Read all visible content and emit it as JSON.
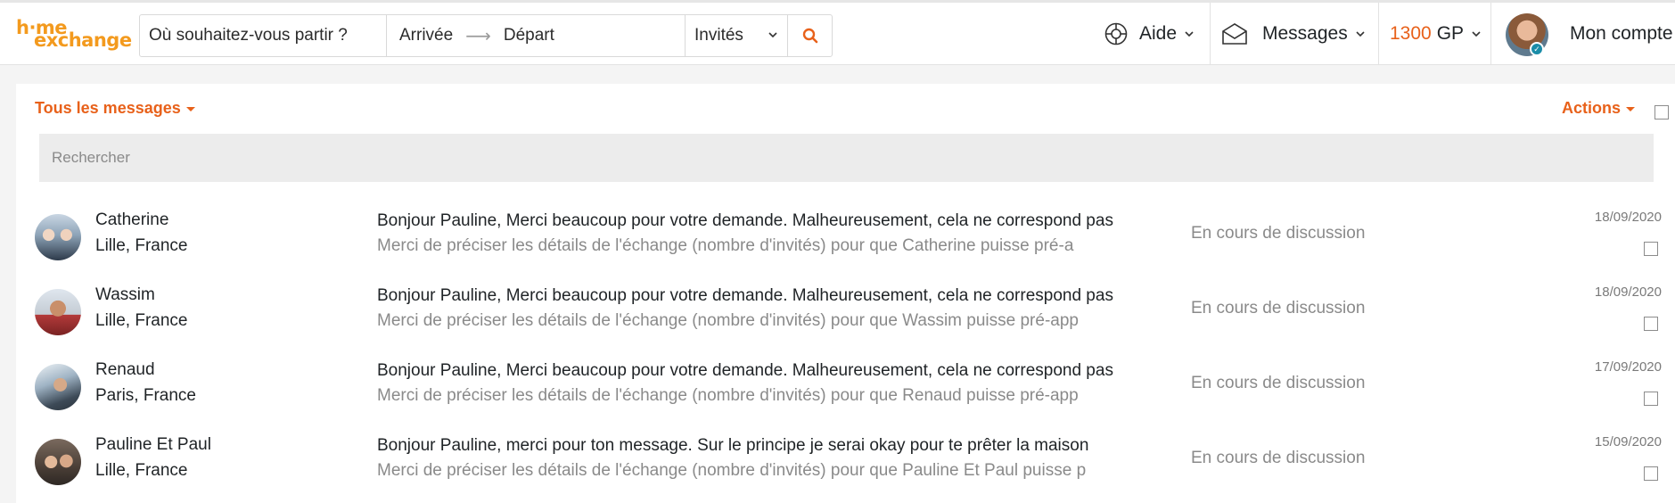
{
  "header": {
    "logo_line1": "h·me",
    "logo_line2": "exchange",
    "search": {
      "destination": "Où souhaitez-vous partir ?",
      "arrival": "Arrivée",
      "departure": "Départ",
      "guests": "Invités"
    },
    "help_label": "Aide",
    "messages_label": "Messages",
    "gp_value": "1300",
    "gp_unit": "GP",
    "account_label": "Mon compte"
  },
  "toolbar": {
    "filter_label": "Tous les messages",
    "actions_label": "Actions",
    "search_placeholder": "Rechercher"
  },
  "conversations": [
    {
      "name": "Catherine",
      "location": "Lille, France",
      "preview": "Bonjour Pauline, Merci beaucoup pour votre demande. Malheureusement, cela ne correspond pas",
      "note": "Merci de préciser les détails de l'échange (nombre d'invités) pour que Catherine puisse pré-a",
      "status": "En cours de discussion",
      "date": "18/09/2020"
    },
    {
      "name": "Wassim",
      "location": "Lille, France",
      "preview": "Bonjour Pauline, Merci beaucoup pour votre demande. Malheureusement, cela ne correspond pas",
      "note": "Merci de préciser les détails de l'échange (nombre d'invités) pour que Wassim puisse pré-app",
      "status": "En cours de discussion",
      "date": "18/09/2020"
    },
    {
      "name": "Renaud",
      "location": "Paris, France",
      "preview": "Bonjour Pauline, Merci beaucoup pour votre demande. Malheureusement, cela ne correspond pas",
      "note": "Merci de préciser les détails de l'échange (nombre d'invités) pour que Renaud puisse pré-app",
      "status": "En cours de discussion",
      "date": "17/09/2020"
    },
    {
      "name": "Pauline Et Paul",
      "location": "Lille, France",
      "preview": "Bonjour Pauline, merci pour ton message. Sur le principe je serai okay pour te prêter la maison",
      "note": "Merci de préciser les détails de l'échange (nombre d'invités) pour que Pauline Et Paul puisse p",
      "status": "En cours de discussion",
      "date": "15/09/2020"
    }
  ],
  "colors": {
    "accent": "#e8611a",
    "logo": "#f39a1e",
    "muted_text": "#8a8a8a"
  }
}
